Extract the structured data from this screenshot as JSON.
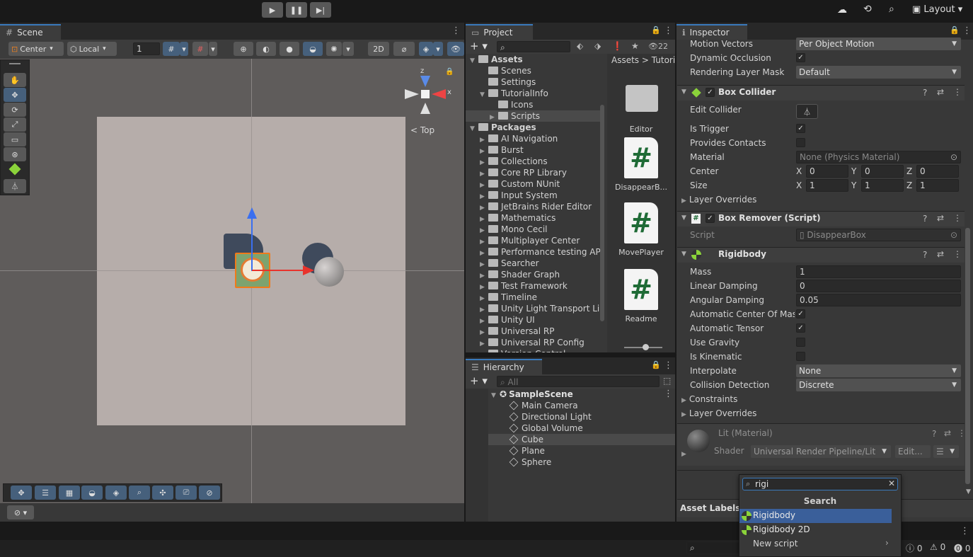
{
  "toolbar": {
    "play_icon": "play-icon",
    "pause_icon": "pause-icon",
    "step_icon": "step-icon",
    "layout_label": "Layout"
  },
  "scene": {
    "tab_label": "Scene",
    "pivot_label": "Center",
    "space_label": "Local",
    "grid_value": "1",
    "orientation_label": "Top",
    "axis_x_label": "x"
  },
  "project": {
    "tab_label": "Project",
    "count_label": "22",
    "breadcrumb": [
      "Assets",
      "Tutori"
    ],
    "tree": [
      {
        "label": "Assets",
        "depth": 0,
        "expanded": true,
        "bold": true
      },
      {
        "label": "Scenes",
        "depth": 1,
        "expanded": false
      },
      {
        "label": "Settings",
        "depth": 1,
        "expanded": false
      },
      {
        "label": "TutorialInfo",
        "depth": 1,
        "expanded": true
      },
      {
        "label": "Icons",
        "depth": 2,
        "expanded": false
      },
      {
        "label": "Scripts",
        "depth": 2,
        "expanded": false,
        "selected": true
      },
      {
        "label": "Packages",
        "depth": 0,
        "expanded": true,
        "bold": true
      },
      {
        "label": "AI Navigation",
        "depth": 1
      },
      {
        "label": "Burst",
        "depth": 1
      },
      {
        "label": "Collections",
        "depth": 1
      },
      {
        "label": "Core RP Library",
        "depth": 1
      },
      {
        "label": "Custom NUnit",
        "depth": 1
      },
      {
        "label": "Input System",
        "depth": 1
      },
      {
        "label": "JetBrains Rider Editor",
        "depth": 1
      },
      {
        "label": "Mathematics",
        "depth": 1
      },
      {
        "label": "Mono Cecil",
        "depth": 1
      },
      {
        "label": "Multiplayer Center",
        "depth": 1
      },
      {
        "label": "Performance testing API",
        "depth": 1
      },
      {
        "label": "Searcher",
        "depth": 1
      },
      {
        "label": "Shader Graph",
        "depth": 1
      },
      {
        "label": "Test Framework",
        "depth": 1
      },
      {
        "label": "Timeline",
        "depth": 1
      },
      {
        "label": "Unity Light Transport Lib",
        "depth": 1
      },
      {
        "label": "Unity UI",
        "depth": 1
      },
      {
        "label": "Universal RP",
        "depth": 1
      },
      {
        "label": "Universal RP Config",
        "depth": 1
      },
      {
        "label": "Version Control",
        "depth": 1
      }
    ],
    "assets": [
      {
        "label": "Editor",
        "kind": "folder"
      },
      {
        "label": "DisappearB...",
        "kind": "script"
      },
      {
        "label": "MovePlayer",
        "kind": "script"
      },
      {
        "label": "Readme",
        "kind": "script"
      }
    ],
    "hash_glyph": "#"
  },
  "hierarchy": {
    "tab_label": "Hierarchy",
    "search_placeholder": "All",
    "scene_name": "SampleScene",
    "items": [
      "Main Camera",
      "Directional Light",
      "Global Volume",
      "Cube",
      "Plane",
      "Sphere"
    ],
    "selected_index": 3
  },
  "inspector": {
    "tab_label": "Inspector",
    "top_fields": [
      {
        "label": "Motion Vectors",
        "value": "Per Object Motion",
        "type": "dropdown"
      },
      {
        "label": "Dynamic Occlusion",
        "type": "check",
        "checked": true
      },
      {
        "label": "Rendering Layer Mask",
        "value": "Default",
        "type": "dropdown"
      }
    ],
    "box_collider": {
      "name": "Box Collider",
      "edit_collider_label": "Edit Collider",
      "is_trigger_label": "Is Trigger",
      "provides_contacts_label": "Provides Contacts",
      "material_label": "Material",
      "material_value": "None (Physics Material)",
      "center_label": "Center",
      "center": [
        "0",
        "0",
        "0"
      ],
      "size_label": "Size",
      "size": [
        "1",
        "1",
        "1"
      ],
      "layer_overrides_label": "Layer Overrides"
    },
    "xyz": [
      "X",
      "Y",
      "Z"
    ],
    "box_remover": {
      "name": "Box Remover (Script)",
      "script_label": "Script",
      "script_value": "DisappearBox"
    },
    "rigidbody": {
      "name": "Rigidbody",
      "fields": [
        {
          "label": "Mass",
          "value": "1",
          "type": "text"
        },
        {
          "label": "Linear Damping",
          "value": "0",
          "type": "text"
        },
        {
          "label": "Angular Damping",
          "value": "0.05",
          "type": "text"
        },
        {
          "label": "Automatic Center Of Mass",
          "type": "check",
          "checked": true
        },
        {
          "label": "Automatic Tensor",
          "type": "check",
          "checked": true
        },
        {
          "label": "Use Gravity",
          "type": "check",
          "checked": false
        },
        {
          "label": "Is Kinematic",
          "type": "check",
          "checked": false
        },
        {
          "label": "Interpolate",
          "value": "None",
          "type": "dropdown"
        },
        {
          "label": "Collision Detection",
          "value": "Discrete",
          "type": "dropdown"
        }
      ],
      "constraints_label": "Constraints",
      "layer_overrides_label": "Layer Overrides"
    },
    "material": {
      "name": "Lit (Material)",
      "shader_label": "Shader",
      "shader_value": "Universal Render Pipeline/Lit",
      "edit_label": "Edit..."
    },
    "asset_labels": "Asset Labels"
  },
  "add_component_popup": {
    "search_value": "rigi",
    "header": "Search",
    "results": [
      "Rigidbody",
      "Rigidbody 2D"
    ],
    "new_script_label": "New script",
    "selected_index": 0
  },
  "status_bar": {
    "log_count": "0",
    "warn_count": "0",
    "error_count": "0"
  },
  "colors": {
    "selection": "#2c5d87",
    "popup_selection": "#3a5f9a",
    "accent_blue": "#3a79bb",
    "script_green": "#1f6b36"
  }
}
